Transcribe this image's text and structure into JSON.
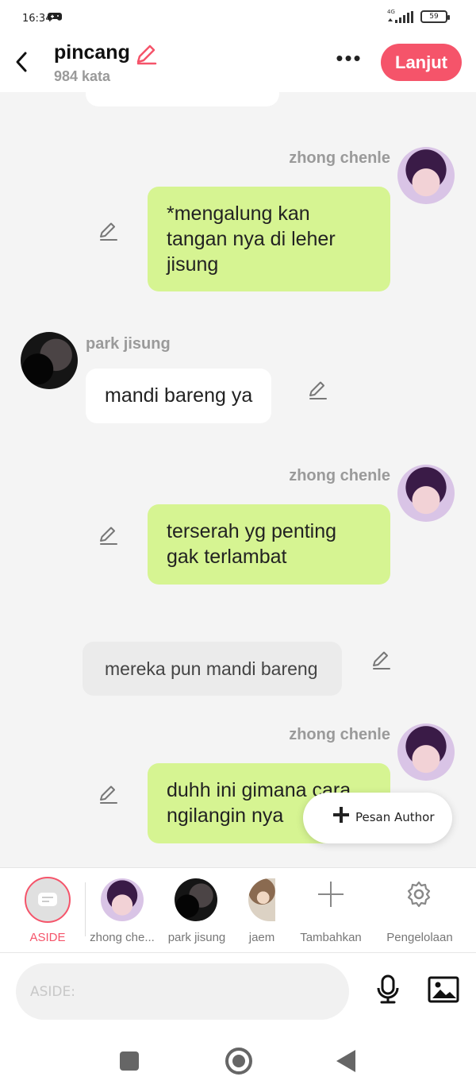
{
  "status_bar": {
    "time": "16:34",
    "network": "4G",
    "battery": "59"
  },
  "header": {
    "title": "pincang",
    "word_count": "984 kata",
    "next_label": "Lanjut",
    "more_icon": "more-horizontal-icon"
  },
  "messages": [
    {
      "side": "right",
      "speaker": "zhong chenle",
      "text": "*mengalung kan tangan nya di leher jisung"
    },
    {
      "side": "left",
      "speaker": "park jisung",
      "text": "mandi bareng ya"
    },
    {
      "side": "right",
      "speaker": "zhong chenle",
      "text": "terserah yg penting gak terlambat"
    },
    {
      "side": "narration",
      "text": "mereka pun mandi bareng"
    },
    {
      "side": "right",
      "speaker": "zhong chenle",
      "text": "duhh ini gimana cara ngilangin nya"
    }
  ],
  "fab": {
    "label": "Pesan Author"
  },
  "characters": {
    "aside": "ASIDE",
    "items": [
      {
        "label": "zhong che...",
        "avatar": "zhong-chenle-avatar"
      },
      {
        "label": "park jisung",
        "avatar": "park-jisung-avatar"
      },
      {
        "label": "jaem",
        "avatar": "jaemin-avatar"
      }
    ],
    "add_label": "Tambahkan",
    "manage_label": "Pengelolaan"
  },
  "input": {
    "placeholder": "ASIDE:"
  },
  "colors": {
    "accent": "#f5546a",
    "bubble_green": "#d6f492"
  }
}
